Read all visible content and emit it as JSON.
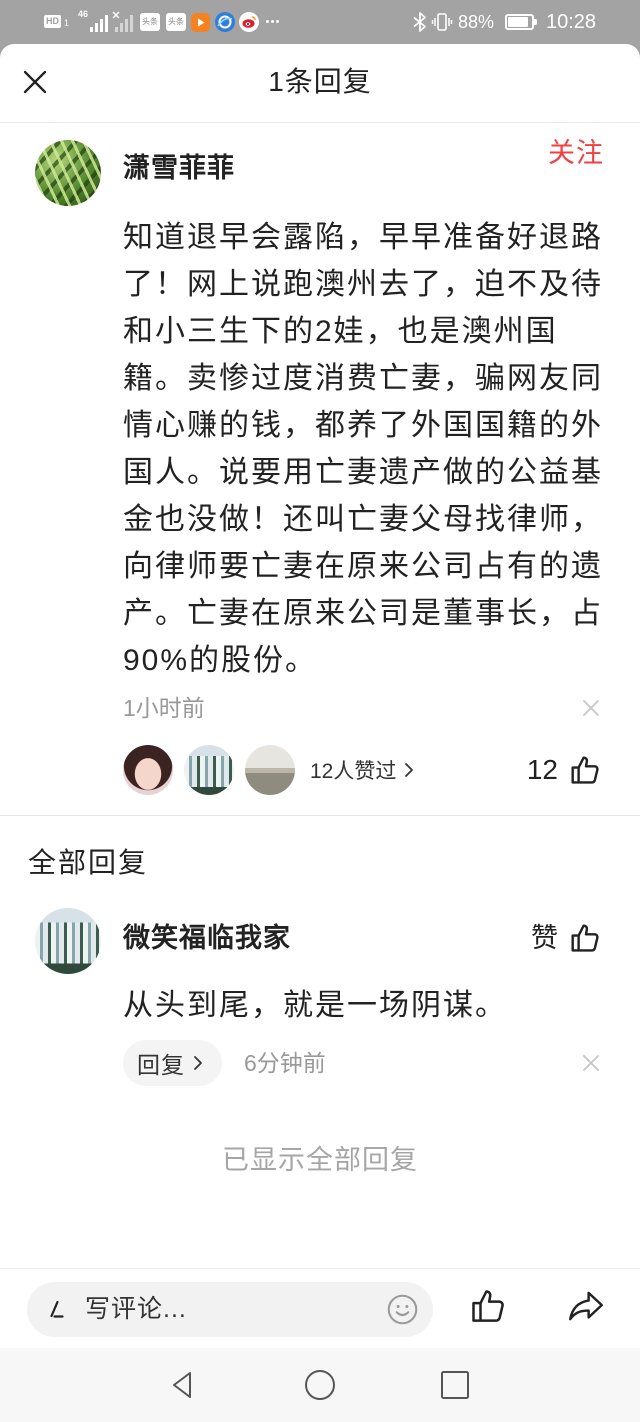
{
  "status_bar": {
    "hd_label": "HD",
    "sim_slot": "1",
    "network_type": "46",
    "app_badges": [
      "头条",
      "头条"
    ],
    "battery_percent": "88%",
    "time": "10:28"
  },
  "header": {
    "title": "1条回复"
  },
  "main_comment": {
    "username": "潇雪菲菲",
    "follow_label": "关注",
    "text": "知道退早会露陷，早早准备好退路了！网上说跑澳州去了，迫不及待和小三生下的2娃，也是澳州国籍。卖惨过度消费亡妻，骗网友同情心赚的钱，都养了外国国籍的外国人。说要用亡妻遗产做的公益基金也没做！还叫亡妻父母找律师，向律师要亡妻在原来公司占有的遗产。亡妻在原来公司是董事长，占90%的股份。",
    "time": "1小时前",
    "liked_by_summary": "12人赞过",
    "like_count": "12"
  },
  "replies": {
    "heading": "全部回复",
    "items": [
      {
        "username": "微笑福临我家",
        "like_label": "赞",
        "text": "从头到尾，就是一场阴谋。",
        "reply_button_label": "回复",
        "time": "6分钟前"
      }
    ],
    "end_notice": "已显示全部回复"
  },
  "composer": {
    "placeholder": "写评论..."
  },
  "icons": {
    "close": "close-icon",
    "dismiss": "close-small-icon",
    "like": "thumbs-up-icon",
    "chevron": "chevron-right-icon",
    "pen": "pen-icon",
    "emoji": "smiley-icon",
    "share": "share-icon",
    "nav_back": "back-triangle-icon",
    "nav_home": "home-circle-icon",
    "nav_recent": "recent-square-icon",
    "status_apps": [
      "video-app-icon",
      "browser-app-icon",
      "weibo-icon"
    ],
    "status_system": [
      "bluetooth-icon",
      "vibrate-icon",
      "battery-icon"
    ]
  },
  "colors": {
    "accent": "#f04142",
    "text_primary": "#222222",
    "text_secondary": "#999999",
    "status_bar_bg": "#a3a3a3",
    "divider": "#e8e8e8"
  }
}
